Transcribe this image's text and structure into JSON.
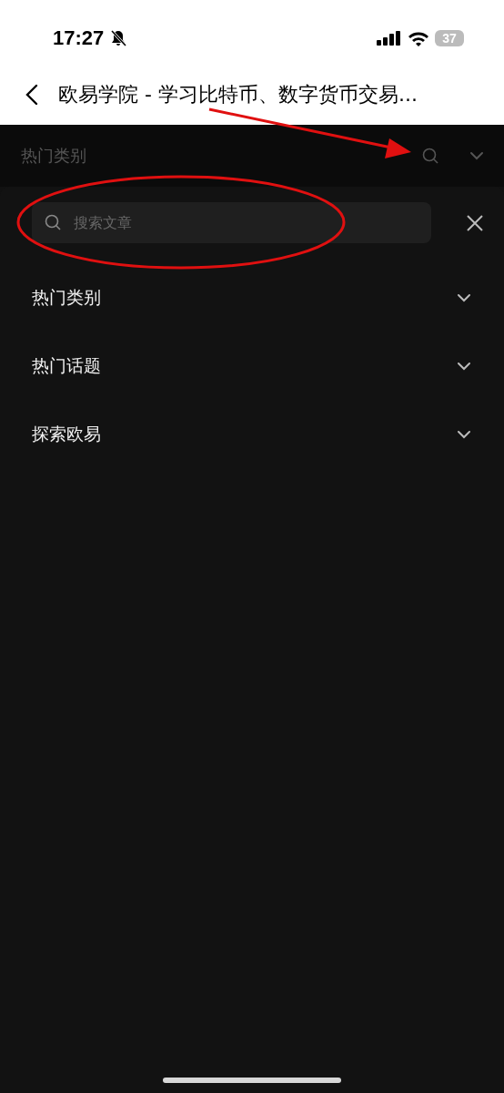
{
  "status_bar": {
    "time": "17:27",
    "silent": true,
    "battery": "37"
  },
  "header": {
    "title": "欧易学院 - 学习比特币、数字货币交易..."
  },
  "category_bar": {
    "label": "热门类别"
  },
  "search": {
    "placeholder": "搜索文章"
  },
  "sections": [
    {
      "label": "热门类别",
      "expanded": false
    },
    {
      "label": "热门话题",
      "expanded": false
    },
    {
      "label": "探索欧易",
      "expanded": false
    }
  ]
}
